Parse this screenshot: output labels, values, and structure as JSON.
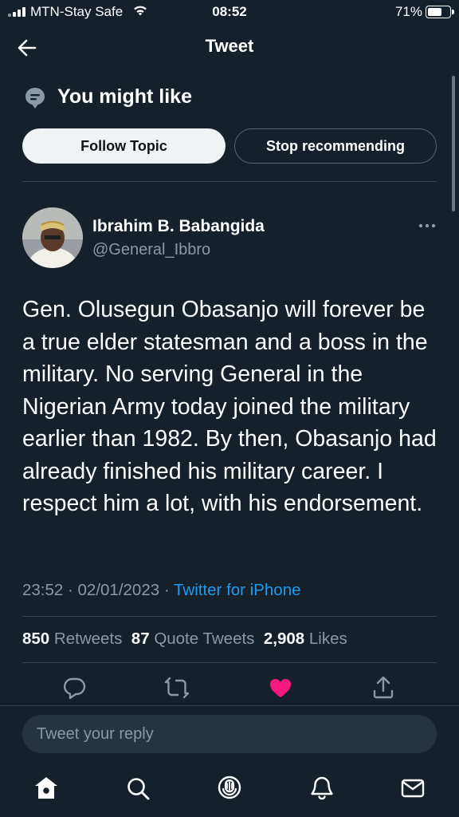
{
  "status_bar": {
    "carrier": "MTN-Stay Safe",
    "time": "08:52",
    "battery_percent": "71%",
    "battery_level": 0.71
  },
  "header": {
    "title": "Tweet",
    "back_icon": "arrow-left-icon"
  },
  "topic": {
    "title": "You might like",
    "icon": "topic-bubble-icon",
    "follow_label": "Follow Topic",
    "stop_label": "Stop recommending"
  },
  "tweet": {
    "author_name": "Ibrahim B. Babangida",
    "author_handle": "@General_Ibbro",
    "text": "Gen. Olusegun Obasanjo will forever be a true elder statesman and a boss in the military. No serving General in the Nigerian Army today joined the military earlier than 1982. By then, Obasanjo had already finished his military career. I respect him a lot, with his endorsement.",
    "time": "23:52",
    "date": "02/01/2023",
    "source": "Twitter for iPhone",
    "stats": {
      "retweets_count": "850",
      "retweets_label": "Retweets",
      "quotes_count": "87",
      "quotes_label": "Quote Tweets",
      "likes_count": "2,908",
      "likes_label": "Likes"
    },
    "liked": true
  },
  "actions": [
    "reply-icon",
    "retweet-icon",
    "heart-icon",
    "share-icon"
  ],
  "reply": {
    "placeholder": "Tweet your reply"
  },
  "bottom_nav": [
    "home-icon",
    "search-icon",
    "spaces-icon",
    "notifications-icon",
    "messages-icon"
  ],
  "colors": {
    "background": "#15202b",
    "accent": "#1d9bf0",
    "like": "#f91880",
    "muted": "#8b98a5"
  }
}
